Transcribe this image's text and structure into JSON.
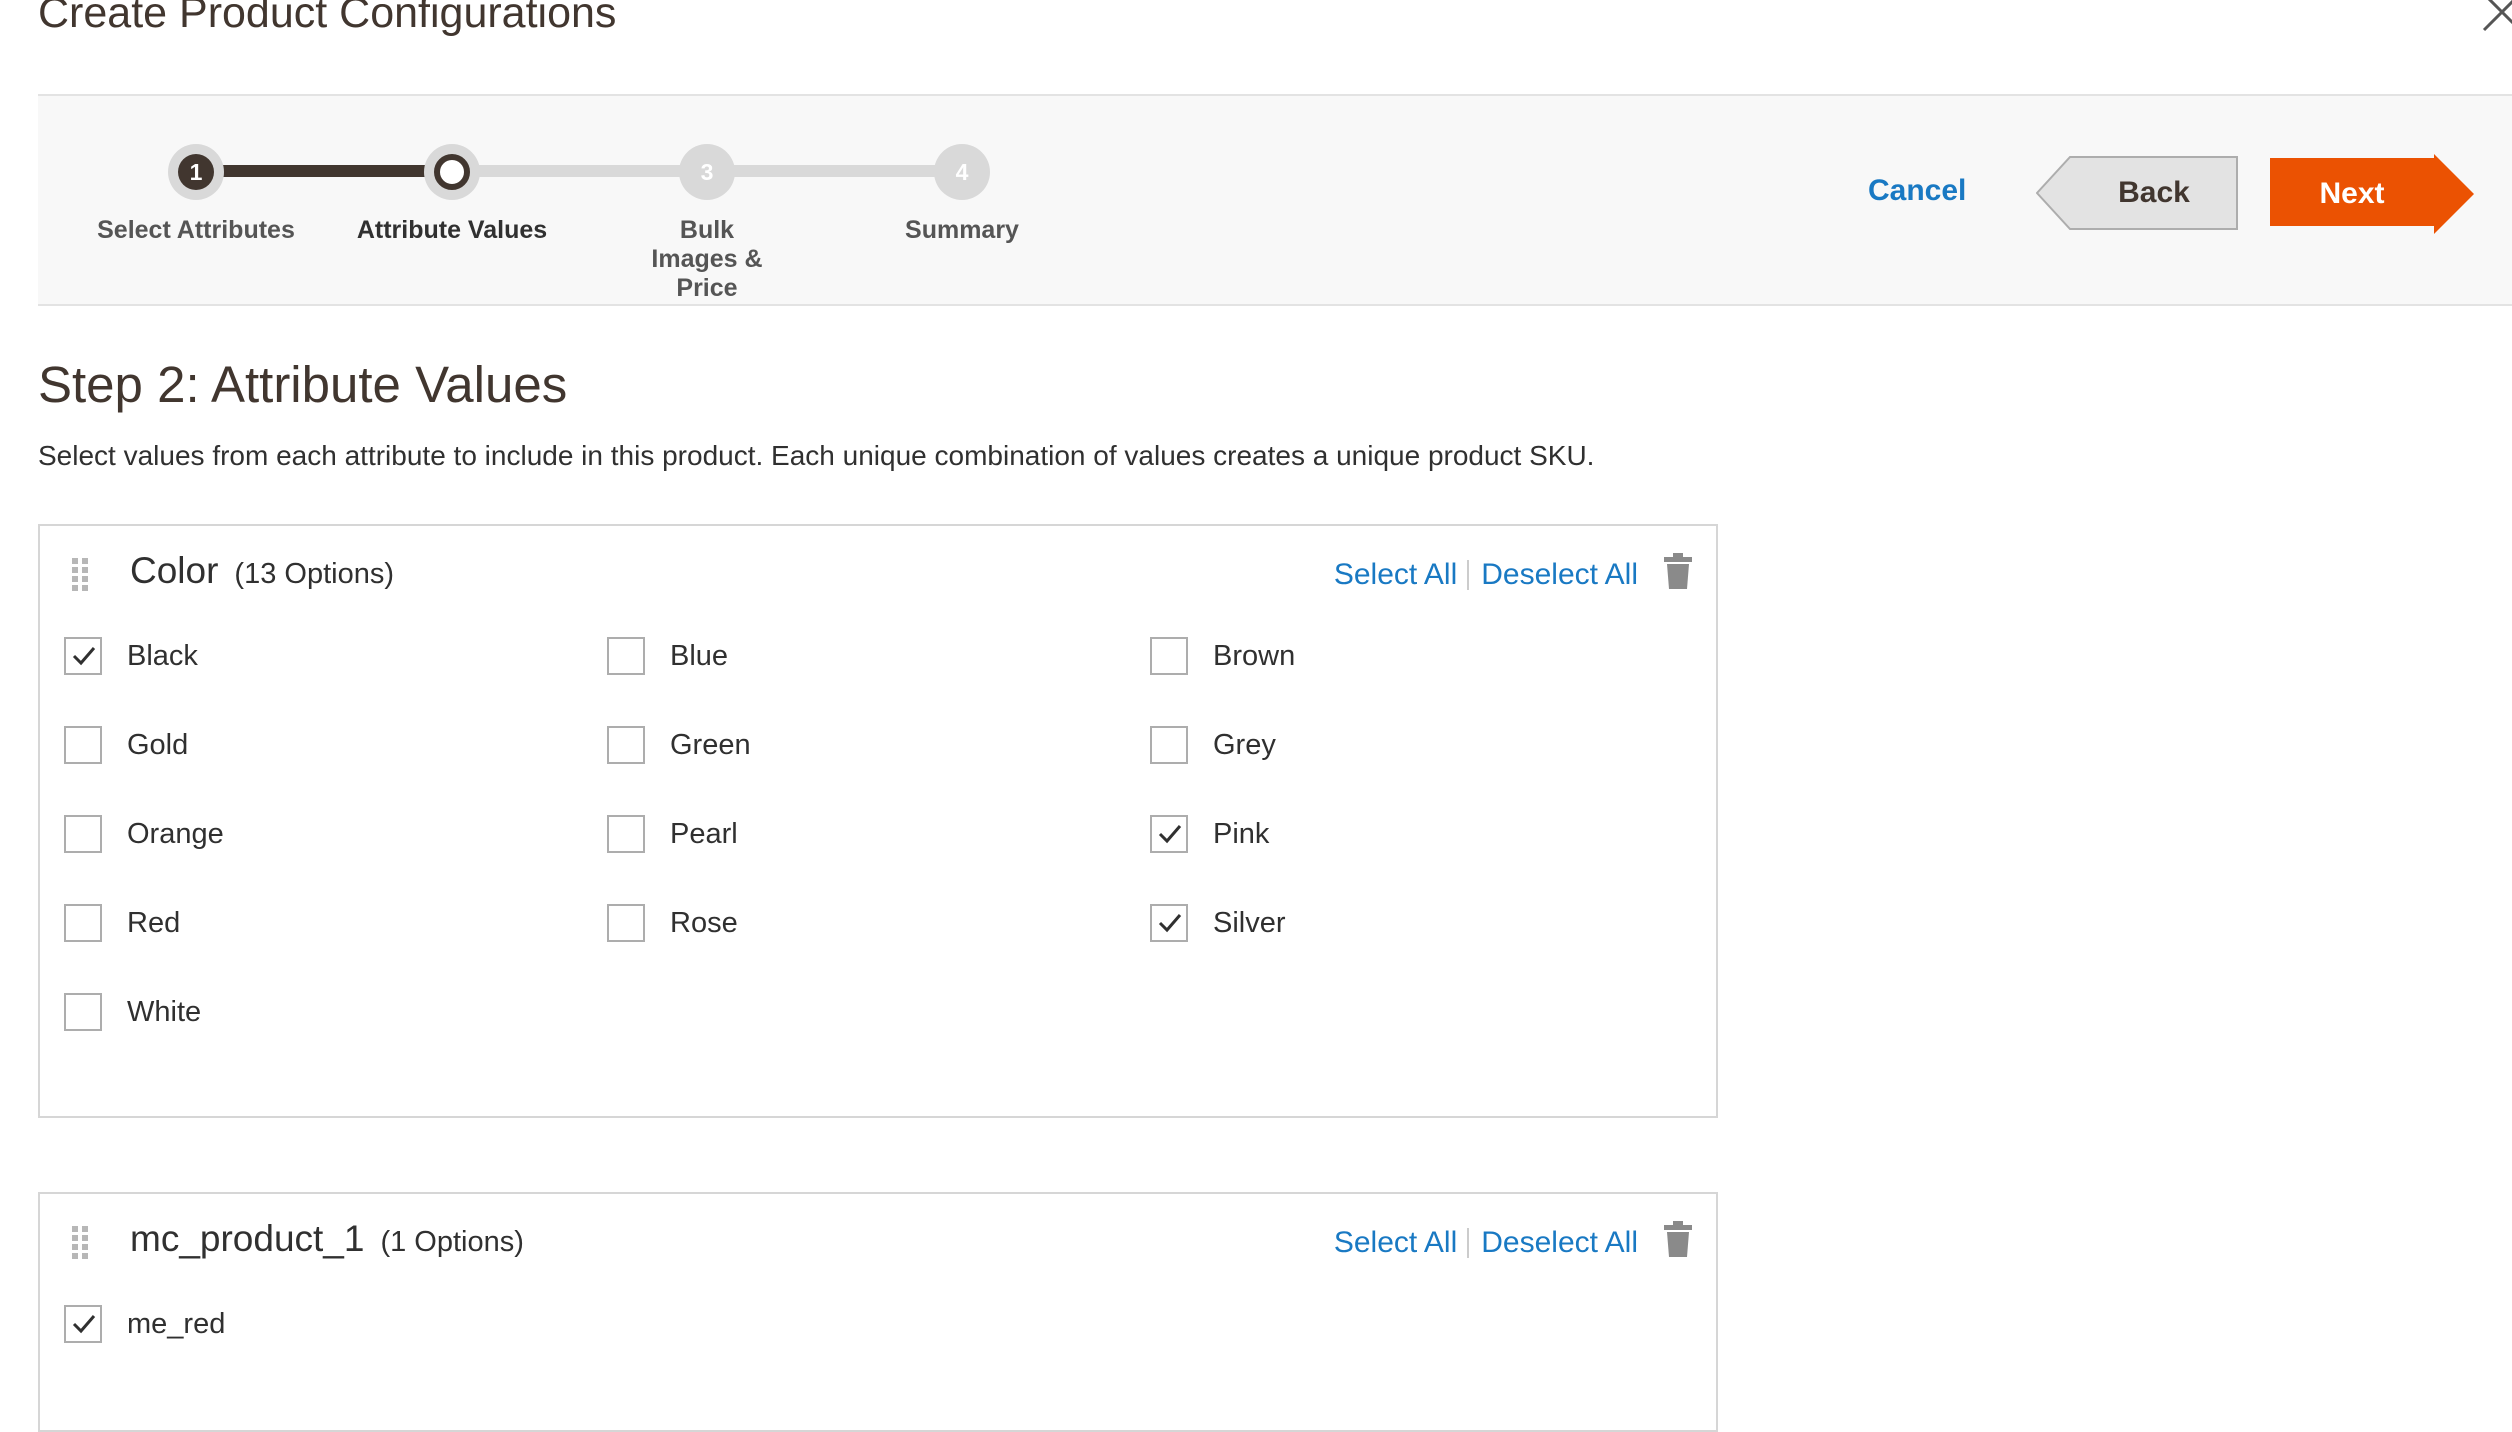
{
  "modal": {
    "title": "Create Product Configurations",
    "close_icon": "close-icon"
  },
  "wizard": {
    "steps": [
      {
        "number": "1",
        "label": "Select Attributes",
        "state": "completed"
      },
      {
        "number": "",
        "label": "Attribute Values",
        "state": "active"
      },
      {
        "number": "3",
        "label": "Bulk Images & Price",
        "state": "pending"
      },
      {
        "number": "4",
        "label": "Summary",
        "state": "pending"
      }
    ],
    "cancel_label": "Cancel",
    "back_label": "Back",
    "next_label": "Next",
    "colors": {
      "accent": "#eb5202",
      "link": "#1979c3",
      "done": "#41362f",
      "pending": "#d9d9d9"
    }
  },
  "step": {
    "heading": "Step 2: Attribute Values",
    "description": "Select values from each attribute to include in this product. Each unique combination of values creates a unique product SKU."
  },
  "attributes": [
    {
      "name": "Color",
      "count": "(13 Options)",
      "select_all": "Select All",
      "deselect_all": "Deselect All",
      "options": [
        {
          "label": "Black",
          "checked": true
        },
        {
          "label": "Blue",
          "checked": false
        },
        {
          "label": "Brown",
          "checked": false
        },
        {
          "label": "Gold",
          "checked": false
        },
        {
          "label": "Green",
          "checked": false
        },
        {
          "label": "Grey",
          "checked": false
        },
        {
          "label": "Orange",
          "checked": false
        },
        {
          "label": "Pearl",
          "checked": false
        },
        {
          "label": "Pink",
          "checked": true
        },
        {
          "label": "Red",
          "checked": false
        },
        {
          "label": "Rose",
          "checked": false
        },
        {
          "label": "Silver",
          "checked": true
        },
        {
          "label": "White",
          "checked": false
        }
      ]
    },
    {
      "name": "mc_product_1",
      "count": "(1 Options)",
      "select_all": "Select All",
      "deselect_all": "Deselect All",
      "options": [
        {
          "label": "me_red",
          "checked": true
        }
      ]
    }
  ]
}
